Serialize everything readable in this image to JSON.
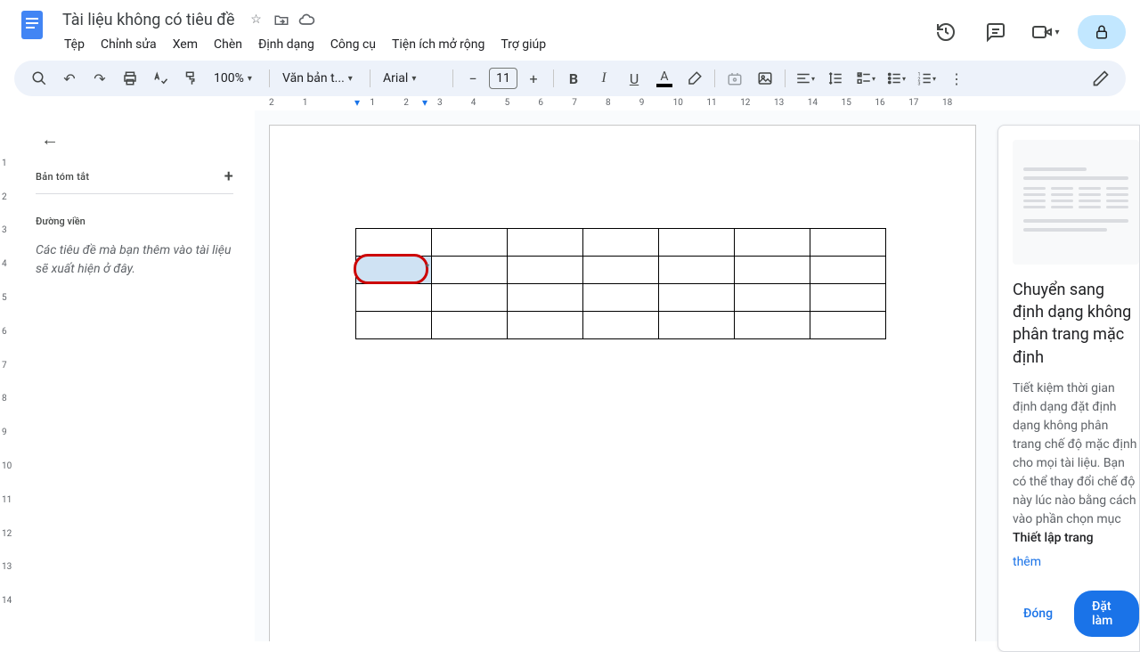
{
  "header": {
    "doc_title": "Tài liệu không có tiêu đề",
    "menus": [
      "Tệp",
      "Chỉnh sửa",
      "Xem",
      "Chèn",
      "Định dạng",
      "Công cụ",
      "Tiện ích mở rộng",
      "Trợ giúp"
    ]
  },
  "toolbar": {
    "zoom": "100%",
    "style": "Văn bản t...",
    "font": "Arial",
    "font_size": "11"
  },
  "ruler": {
    "h_ticks": [
      "2",
      "1",
      "",
      "1",
      "2",
      "3",
      "4",
      "5",
      "6",
      "7",
      "8",
      "9",
      "10",
      "11",
      "12",
      "13",
      "14",
      "15",
      "16",
      "17",
      "18"
    ],
    "v_ticks": [
      "",
      "1",
      "2",
      "3",
      "4",
      "5",
      "6",
      "7",
      "8",
      "9",
      "10",
      "11",
      "12",
      "13",
      "14"
    ]
  },
  "outline": {
    "summary_label": "Bản tóm tắt",
    "outline_label": "Đường viền",
    "empty_text": "Các tiêu đề mà bạn thêm vào tài liệu sẽ xuất hiện ở đây."
  },
  "document": {
    "table": {
      "rows": 4,
      "cols": 7,
      "selected": {
        "row": 1,
        "col": 0
      }
    }
  },
  "promo": {
    "title": "Chuyển sang định dạng không phân trang mặc định",
    "body_1": "Tiết kiệm thời gian định dạng đặt định dạng không phân trang chế độ mặc định cho mọi tài liệu. Bạn có thể thay đổi chế độ này lúc nào bằng cách vào phần chọn mục ",
    "body_bold": "Thiết lập trang",
    "link": "thêm",
    "btn_close": "Đóng",
    "btn_primary": "Đặt làm"
  }
}
